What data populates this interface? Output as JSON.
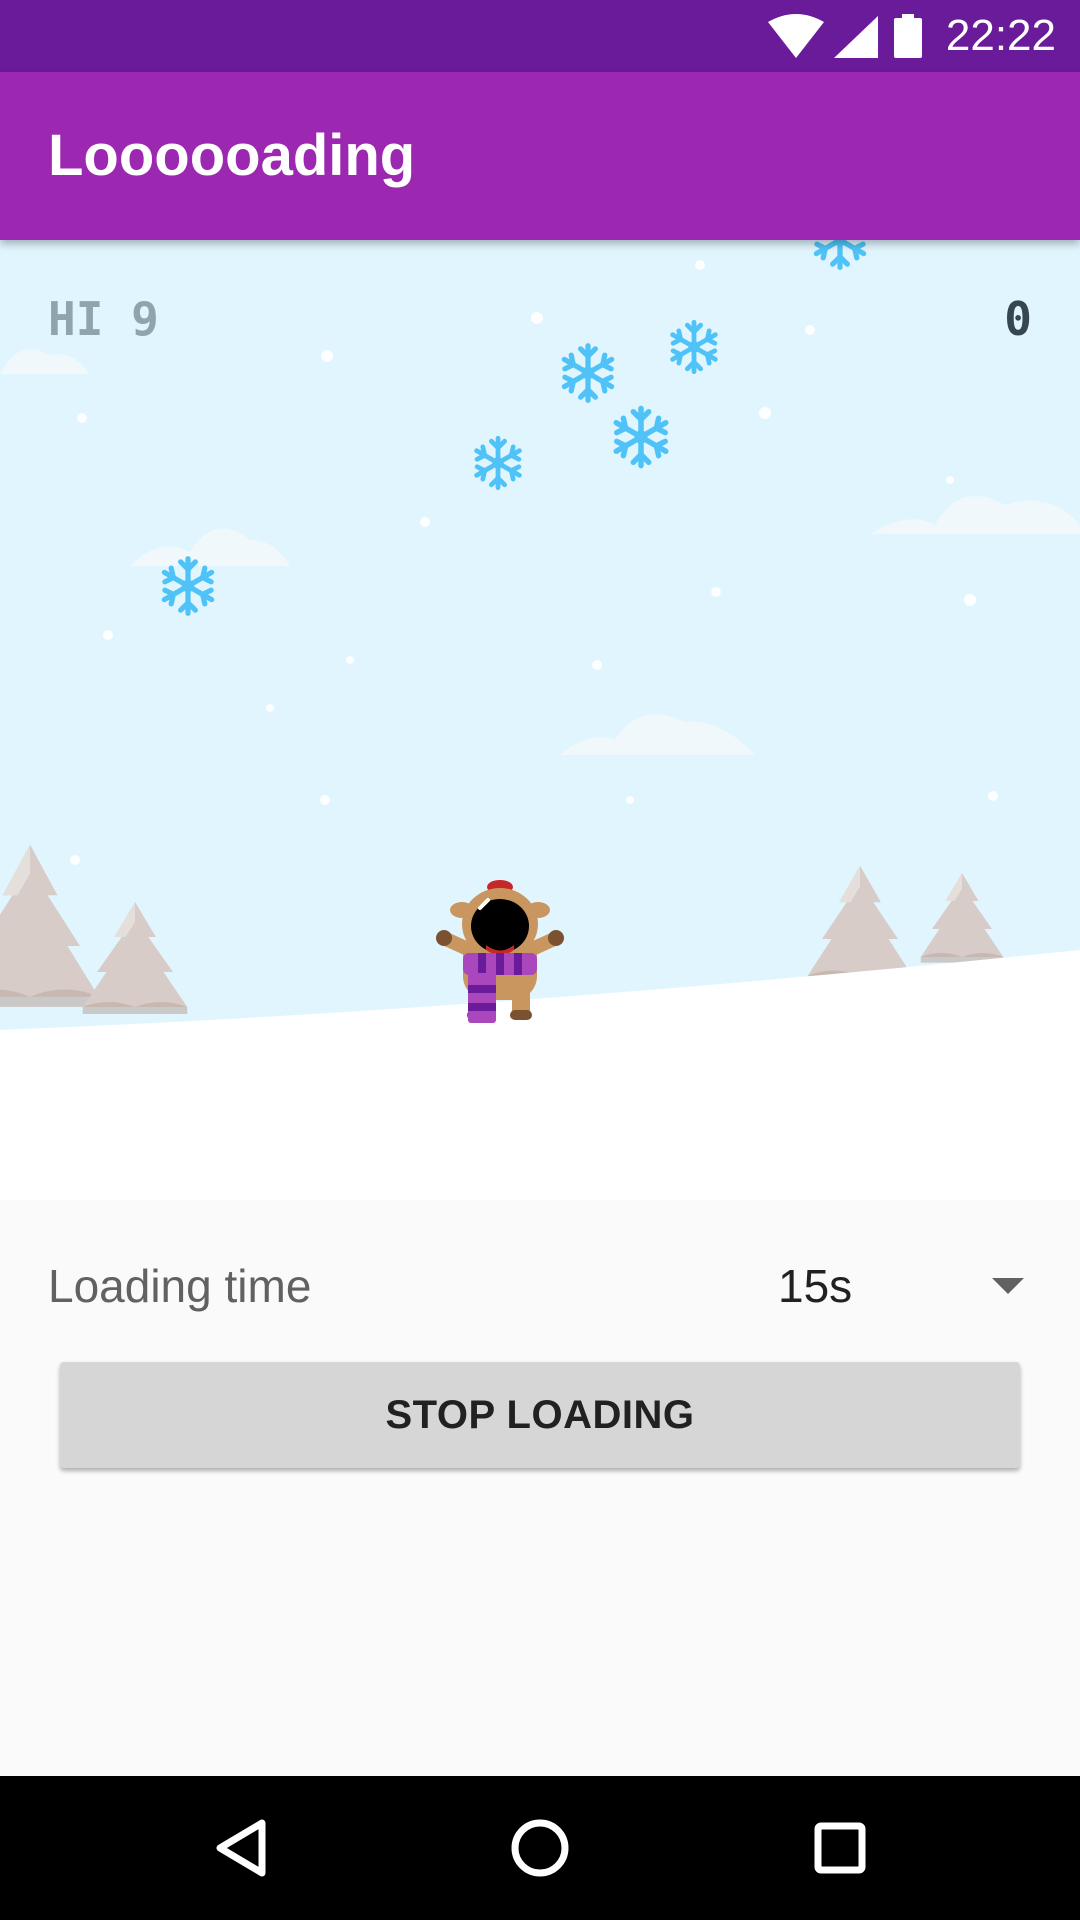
{
  "status_bar": {
    "time": "22:22",
    "icons": [
      "wifi-icon",
      "cell-signal-icon",
      "battery-icon"
    ]
  },
  "app_bar": {
    "title": "Loooooading"
  },
  "game": {
    "hi_score_label": "HI 9",
    "score": "0",
    "character": "reindeer-in-scarf",
    "sky_color": "#e1f5fe",
    "snowflake_color": "#4fc3f7"
  },
  "controls": {
    "loading_time_label": "Loading time",
    "loading_time_value": "15s",
    "stop_button_label": "STOP LOADING"
  },
  "nav_bar": {
    "buttons": [
      "back-icon",
      "home-icon",
      "recents-icon"
    ]
  },
  "colors": {
    "status_bar": "#6a1b9a",
    "app_bar": "#9c27b0",
    "button": "#d6d6d6"
  }
}
